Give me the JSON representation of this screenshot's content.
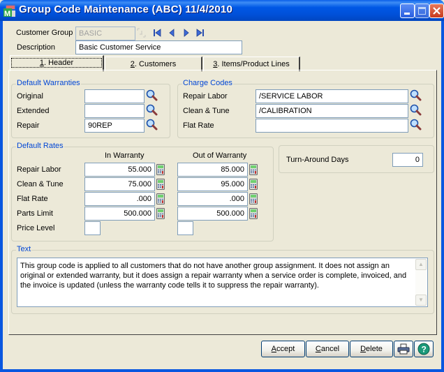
{
  "window": {
    "title": "Group Code Maintenance (ABC) 11/4/2010",
    "controls": [
      "minimize",
      "maximize",
      "close"
    ]
  },
  "header": {
    "customer_group_label": "Customer Group",
    "customer_group_value": "BASIC",
    "description_label": "Description",
    "description_value": "Basic Customer Service",
    "nav_icons": [
      "lookup-disabled-icon",
      "first-record-icon",
      "previous-record-icon",
      "next-record-icon",
      "last-record-icon"
    ]
  },
  "tabs": [
    {
      "key": "1",
      "label": ". Header",
      "active": true
    },
    {
      "key": "2",
      "label": ". Customers",
      "active": false
    },
    {
      "key": "3",
      "label": ". Items/Product Lines",
      "active": false
    }
  ],
  "default_warranties": {
    "title": "Default Warranties",
    "rows": [
      {
        "label": "Original",
        "value": ""
      },
      {
        "label": "Extended",
        "value": ""
      },
      {
        "label": "Repair",
        "value": "90REP"
      }
    ]
  },
  "charge_codes": {
    "title": "Charge Codes",
    "rows": [
      {
        "label": "Repair Labor",
        "value": "/SERVICE LABOR"
      },
      {
        "label": "Clean & Tune",
        "value": "/CALIBRATION"
      },
      {
        "label": "Flat Rate",
        "value": ""
      }
    ]
  },
  "default_rates": {
    "title": "Default Rates",
    "col_in": "In Warranty",
    "col_out": "Out of Warranty",
    "rows": [
      {
        "label": "Repair Labor",
        "in": "55.000",
        "out": "85.000"
      },
      {
        "label": "Clean & Tune",
        "in": "75.000",
        "out": "95.000"
      },
      {
        "label": "Flat Rate",
        "in": ".000",
        "out": ".000"
      },
      {
        "label": "Parts Limit",
        "in": "500.000",
        "out": "500.000"
      }
    ],
    "price_level_label": "Price Level",
    "price_level_in": "",
    "price_level_out": ""
  },
  "turnaround": {
    "label": "Turn-Around Days",
    "value": "0"
  },
  "text_section": {
    "title": "Text",
    "body": "This group code is applied to all customers that do not have another group assignment.  It does not assign an original or extended warranty, but it does assign a repair warranty when a service order is complete, invoiced, and the invoice is updated (unless the warranty code tells it to suppress the repair warranty)."
  },
  "buttons": {
    "accept_key": "A",
    "accept_rest": "ccept",
    "cancel_key": "C",
    "cancel_rest": "ancel",
    "delete_key": "D",
    "delete_rest": "elete"
  },
  "colors": {
    "titlebar": "#0054e3",
    "group_title": "#0046d5",
    "window_bg": "#ece9d8",
    "field_border": "#7f9db9"
  }
}
